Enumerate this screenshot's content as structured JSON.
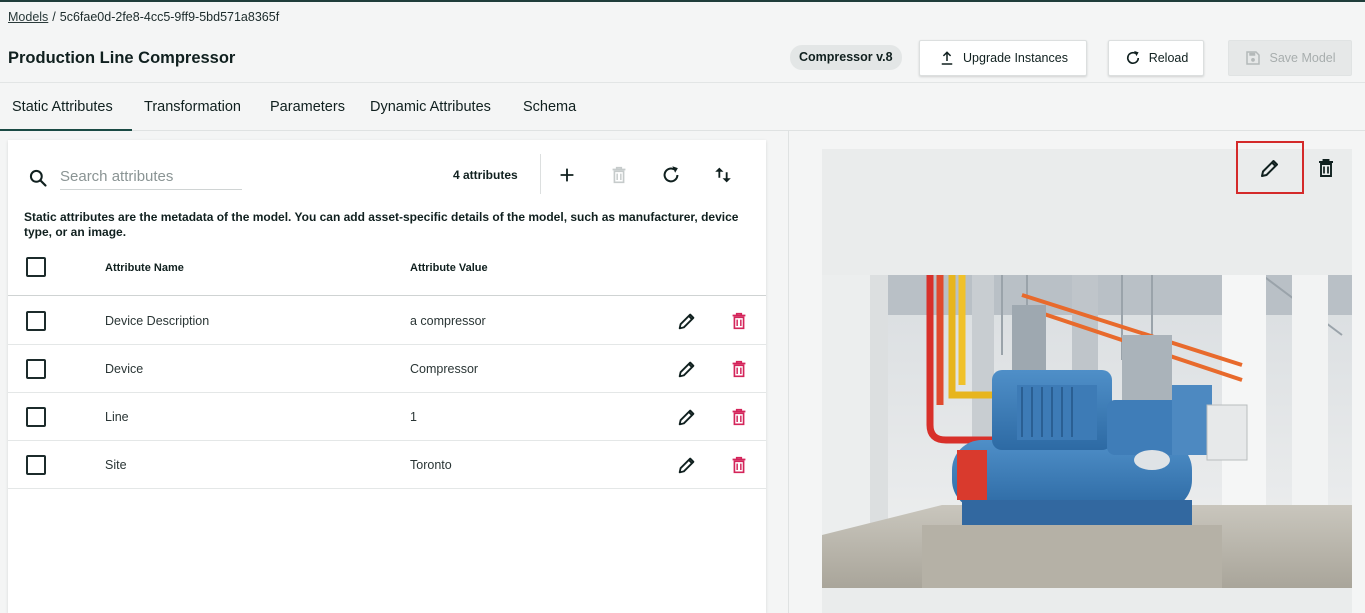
{
  "breadcrumb": {
    "root": "Models",
    "separator": "/",
    "current": "5c6fae0d-2fe8-4cc5-9ff9-5bd571a8365f"
  },
  "header": {
    "title": "Production Line Compressor",
    "version_badge": "Compressor v.8",
    "upgrade_label": "Upgrade Instances",
    "reload_label": "Reload",
    "save_label": "Save Model"
  },
  "tabs": [
    {
      "label": "Static Attributes",
      "active": true
    },
    {
      "label": "Transformation",
      "active": false
    },
    {
      "label": "Parameters",
      "active": false
    },
    {
      "label": "Dynamic Attributes",
      "active": false
    },
    {
      "label": "Schema",
      "active": false
    }
  ],
  "attributes_panel": {
    "search_placeholder": "Search attributes",
    "count_label": "4 attributes",
    "description": "Static attributes are the metadata of the model. You can add asset-specific details of the model, such as manufacturer, device type, or an image.",
    "columns": {
      "name": "Attribute Name",
      "value": "Attribute Value"
    },
    "rows": [
      {
        "name": "Device Description",
        "value": "a compressor"
      },
      {
        "name": "Device",
        "value": "Compressor"
      },
      {
        "name": "Line",
        "value": "1"
      },
      {
        "name": "Site",
        "value": "Toronto"
      }
    ],
    "tools": [
      "add-icon",
      "trash-icon",
      "refresh-icon",
      "sort-icon"
    ]
  },
  "image_panel": {
    "highlighted_action": "edit-image"
  },
  "colors": {
    "accent": "#1a4a44",
    "delete_red": "#d4245a",
    "highlight_box": "#d42a2a",
    "header_bg": "#f4f5f5"
  }
}
